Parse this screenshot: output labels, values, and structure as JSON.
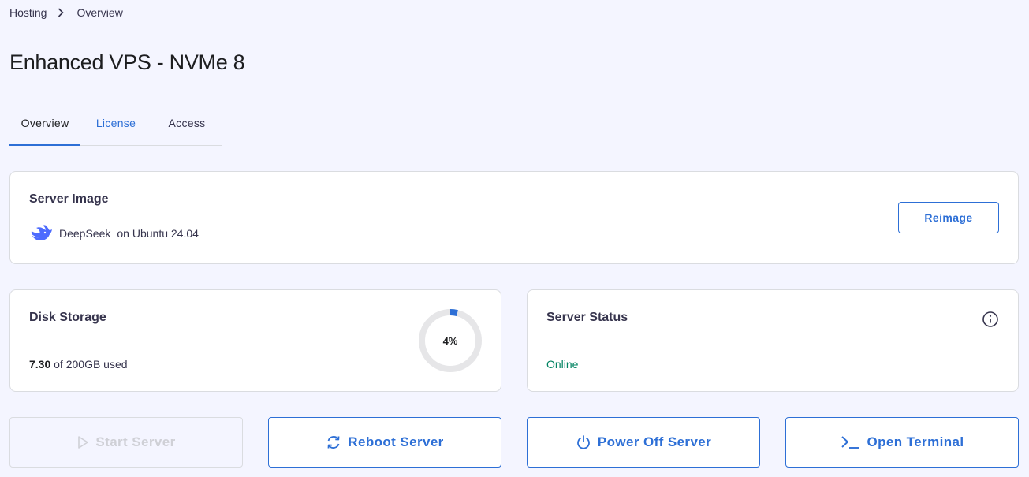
{
  "breadcrumb": {
    "parent": "Hosting",
    "current": "Overview"
  },
  "page": {
    "title": "Enhanced VPS - NVMe 8"
  },
  "tabs": [
    {
      "label": "Overview",
      "active": true
    },
    {
      "label": "License",
      "active": false
    },
    {
      "label": "Access",
      "active": false
    }
  ],
  "server_image": {
    "title": "Server Image",
    "app_name": "DeepSeek",
    "os": "on Ubuntu 24.04",
    "logo_icon": "deepseek-whale-icon",
    "reimage_label": "Reimage"
  },
  "disk_storage": {
    "title": "Disk Storage",
    "used_value": "7.30",
    "used_suffix": "of 200GB used",
    "percent_label": "4%",
    "percent": 4
  },
  "server_status": {
    "title": "Server Status",
    "status": "Online",
    "status_color": "#008361"
  },
  "actions": [
    {
      "label": "Start Server",
      "icon": "play-icon",
      "disabled": true
    },
    {
      "label": "Reboot Server",
      "icon": "refresh-icon",
      "disabled": false
    },
    {
      "label": "Power Off Server",
      "icon": "power-icon",
      "disabled": false
    },
    {
      "label": "Open Terminal",
      "icon": "terminal-icon",
      "disabled": false
    }
  ],
  "colors": {
    "accent": "#2d6fd6",
    "background": "#f4f5ff",
    "border": "#dadce0",
    "online": "#008361"
  }
}
